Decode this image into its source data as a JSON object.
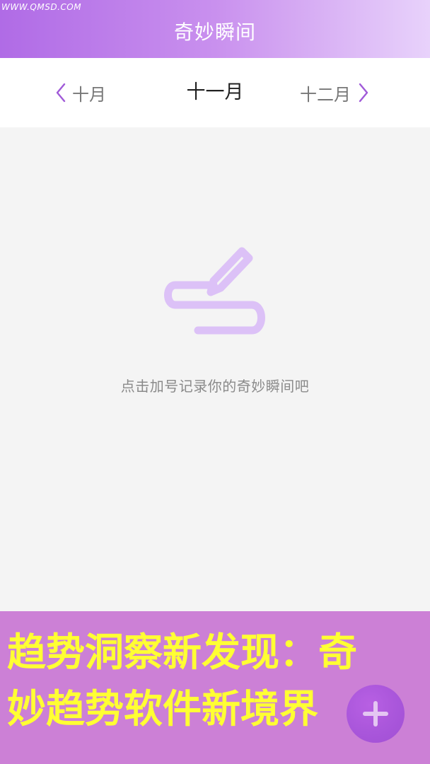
{
  "watermark": "WWW.QMSD.COM",
  "header": {
    "title": "奇妙瞬间"
  },
  "months": {
    "prev": "十月",
    "current": "十一月",
    "next": "十二月"
  },
  "empty_state": {
    "message": "点击加号记录你的奇妙瞬间吧",
    "icon": "pen-squiggle-icon"
  },
  "banner": {
    "line1": "趋势洞察新发现：奇",
    "line2": "妙趋势软件新境界"
  },
  "fab": {
    "icon": "plus-icon"
  },
  "colors": {
    "accent": "#b06be6",
    "illustration": "#dcc1f7",
    "banner_bg": "#cc80d6",
    "banner_text": "#ffff33"
  }
}
